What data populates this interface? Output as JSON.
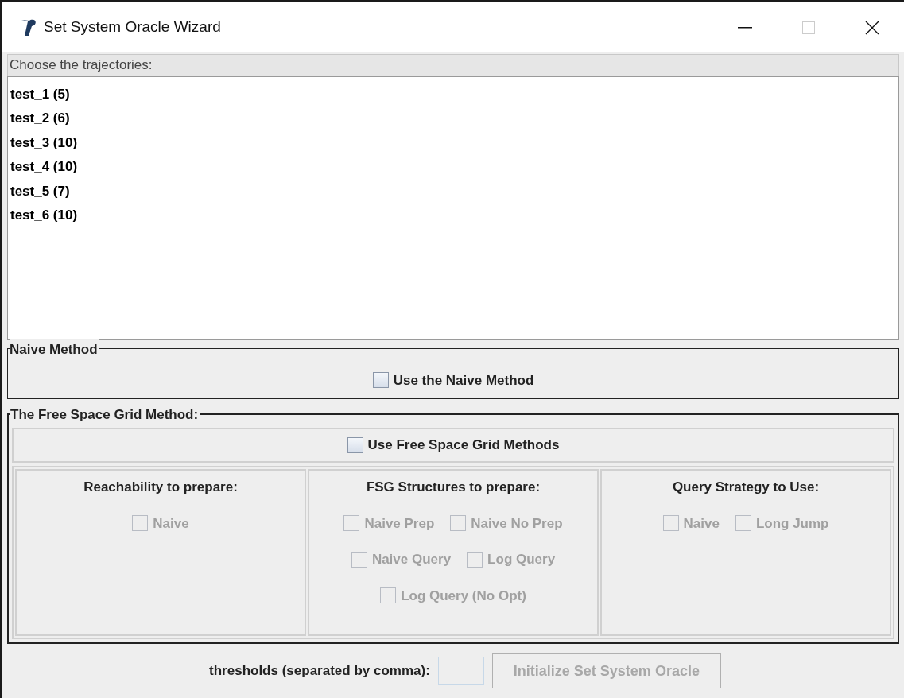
{
  "window": {
    "title": "Set System Oracle Wizard"
  },
  "list_label": "Choose the trajectories:",
  "trajectories": [
    {
      "label": "test_1 (5)",
      "selected": false
    },
    {
      "label": "test_2 (6)",
      "selected": false
    },
    {
      "label": "test_3 (10)",
      "selected": false
    },
    {
      "label": "test_4 (10)",
      "selected": false
    },
    {
      "label": "test_5 (7)",
      "selected": false
    },
    {
      "label": "test_6 (10)",
      "selected": false
    }
  ],
  "naive_group": {
    "title": "Naive Method",
    "checkbox": {
      "label": "Use the Naive Method",
      "checked": false,
      "disabled": false
    }
  },
  "fsg_group": {
    "title": "The Free Space Grid Method:",
    "checkbox": {
      "label": "Use Free Space Grid Methods",
      "checked": false,
      "disabled": false
    },
    "columns": [
      {
        "heading": "Reachability to prepare:",
        "rows": [
          [
            {
              "label": "Naive",
              "checked": false,
              "disabled": true
            }
          ]
        ]
      },
      {
        "heading": "FSG Structures to prepare:",
        "rows": [
          [
            {
              "label": "Naive Prep",
              "checked": false,
              "disabled": true
            },
            {
              "label": "Naive No Prep",
              "checked": false,
              "disabled": true
            }
          ],
          [
            {
              "label": "Naive Query",
              "checked": false,
              "disabled": true
            },
            {
              "label": "Log Query",
              "checked": false,
              "disabled": true
            }
          ],
          [
            {
              "label": "Log Query (No Opt)",
              "checked": false,
              "disabled": true
            }
          ]
        ]
      },
      {
        "heading": "Query Strategy to Use:",
        "rows": [
          [
            {
              "label": "Naive",
              "checked": false,
              "disabled": true
            },
            {
              "label": "Long Jump",
              "checked": false,
              "disabled": true
            }
          ]
        ]
      }
    ]
  },
  "thresholds": {
    "label": "thresholds (separated by comma):"
  },
  "init_button": {
    "label": "Initialize Set System Oracle",
    "disabled": true
  }
}
